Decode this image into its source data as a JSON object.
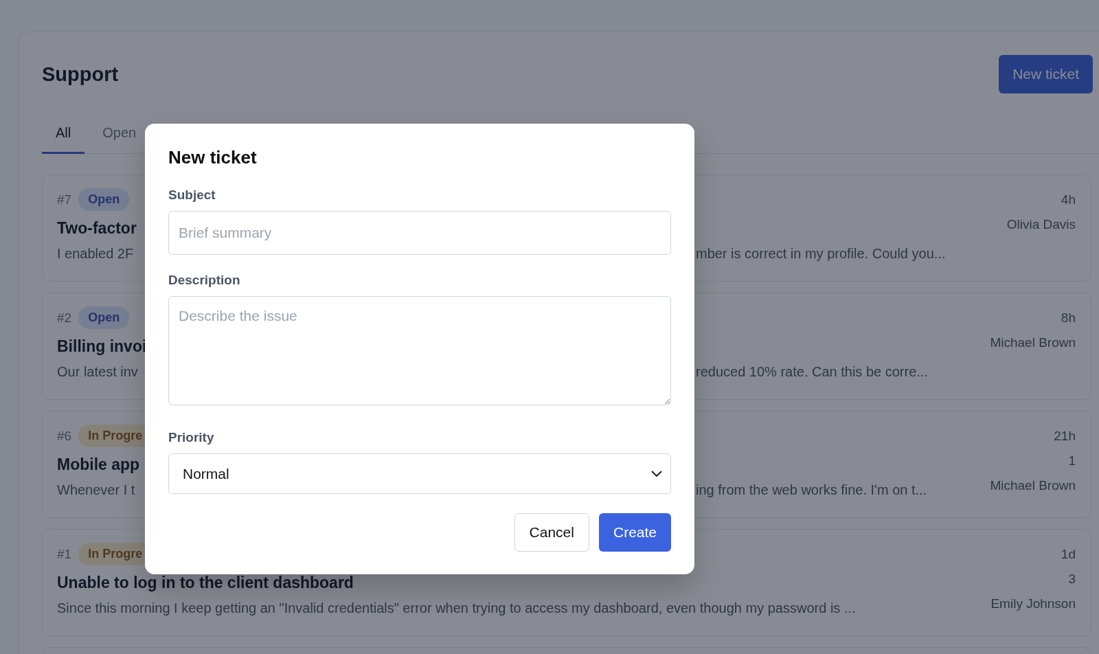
{
  "header": {
    "title": "Support",
    "action": "New ticket"
  },
  "tabs": [
    {
      "label": "All",
      "selected": true
    },
    {
      "label": "Open",
      "selected": false
    }
  ],
  "tickets": [
    {
      "number": "#7",
      "status": {
        "label": "Open",
        "kind": "open"
      },
      "title": "Two-factor",
      "description": "I enabled 2F",
      "description_right": "mber is correct in my profile. Could you...",
      "age": "4h",
      "author": "Olivia Davis"
    },
    {
      "number": "#2",
      "status": {
        "label": "Open",
        "kind": "open"
      },
      "title": "Billing invoi",
      "description": "Our latest inv",
      "description_right": "reduced 10% rate. Can this be corre...",
      "age": "8h",
      "author": "Michael Brown"
    },
    {
      "number": "#6",
      "status": {
        "label": "In Progre",
        "kind": "progress"
      },
      "title": "Mobile app",
      "description": "Whenever I t",
      "description_right": "ing from the web works fine. I'm on t...",
      "age": "21h",
      "count": "1",
      "author": "Michael Brown"
    },
    {
      "number": "#1",
      "status": {
        "label": "In Progre",
        "kind": "progress"
      },
      "title": "Unable to log in to the client dashboard",
      "description": "Since this morning I keep getting an \"Invalid credentials\" error when trying to access my dashboard, even though my password is ...",
      "age": "1d",
      "count": "3",
      "author": "Emily Johnson"
    }
  ],
  "dialog": {
    "title": "New ticket",
    "subject": {
      "label": "Subject",
      "placeholder": "Brief summary"
    },
    "description": {
      "label": "Description",
      "placeholder": "Describe the issue"
    },
    "priority": {
      "label": "Priority",
      "value": "Normal"
    },
    "buttons": [
      {
        "label": "Cancel",
        "kind": "secondary"
      },
      {
        "label": "Create",
        "kind": "primary"
      }
    ]
  }
}
